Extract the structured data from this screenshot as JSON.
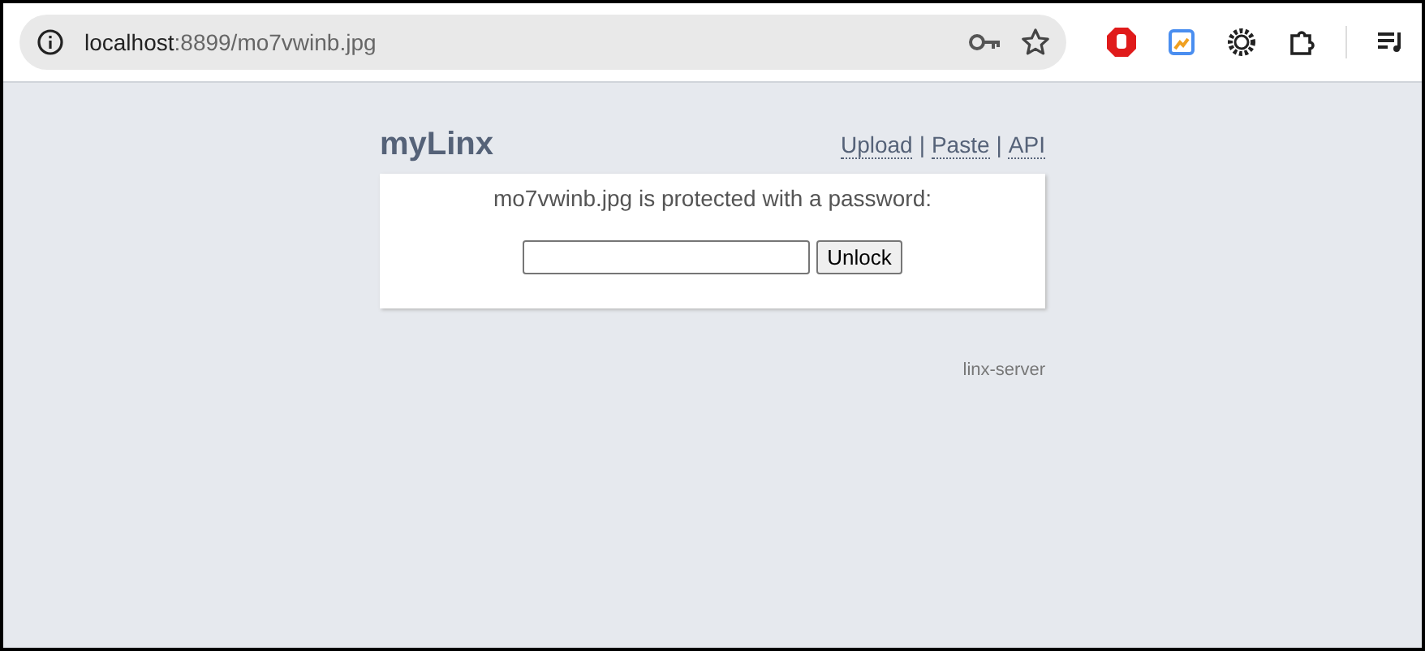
{
  "browser": {
    "url_host": "localhost",
    "url_rest": ":8899/mo7vwinb.jpg"
  },
  "header": {
    "title": "myLinx",
    "nav": [
      "Upload",
      "Paste",
      "API"
    ],
    "separator": "|"
  },
  "lock_box": {
    "message": "mo7vwinb.jpg is protected with a password:",
    "button": "Unlock"
  },
  "footer": "linx-server"
}
